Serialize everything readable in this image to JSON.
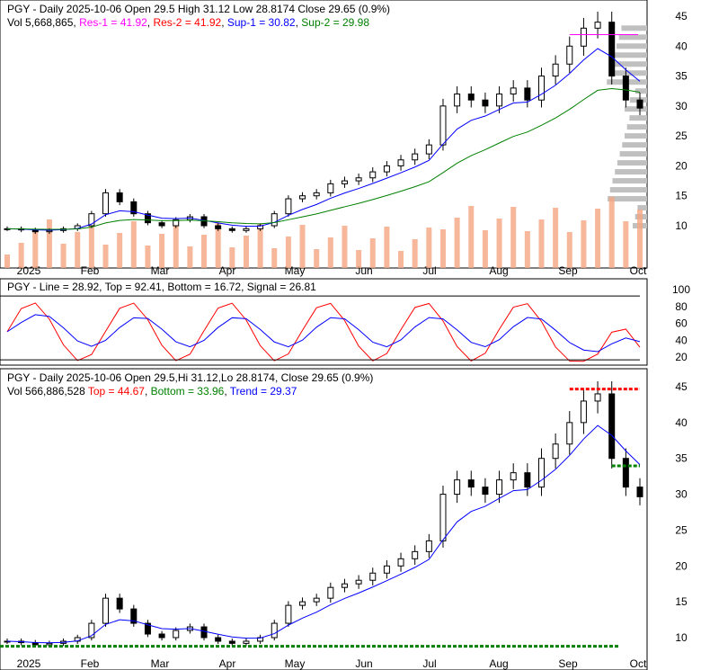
{
  "chart_data": [
    {
      "type": "candlestick",
      "title": "PGY - Daily 2025-10-06 Open 29.5  High 31.12  Low 28.8174  Close 29.65 (0.9%)",
      "legend": {
        "vol": "Vol 5,668,865",
        "res1": "Res-1 = 41.92",
        "res2": "Res-2 = 41.92",
        "sup1": "Sup-1 = 30.82",
        "sup2": "Sup-2 = 29.98"
      },
      "ylim": [
        8,
        46
      ],
      "yticks": [
        10,
        15,
        20,
        25,
        30,
        35,
        40,
        45
      ],
      "xticks": [
        "2025",
        "Feb",
        "Mar",
        "Apr",
        "May",
        "Jun",
        "Jul",
        "Aug",
        "Sep",
        "Oct"
      ],
      "weekly_close": [
        9.5,
        9.3,
        9.0,
        9.2,
        9.5,
        10,
        12,
        15.5,
        14,
        12,
        10.5,
        10,
        11,
        11.5,
        10,
        9.5,
        9.2,
        9.5,
        10,
        12,
        14.5,
        15,
        15.5,
        17,
        17.5,
        18,
        19,
        20,
        21,
        22,
        23.5,
        30,
        32,
        31,
        30,
        32,
        33,
        31,
        35,
        37,
        40,
        43,
        44,
        35,
        31,
        29.65
      ],
      "colors": {
        "res1": "#ff00ff",
        "res2": "#ff0000",
        "sup1": "#0000ff",
        "sup2": "#008000",
        "volume": "#f4a582"
      }
    },
    {
      "type": "line",
      "title": "PGY - Line = 28.92, Top = 92.41, Bottom = 16.72, Signal = 26.81",
      "ylim": [
        10,
        105
      ],
      "yticks": [
        20,
        40,
        60,
        80,
        100
      ]
    },
    {
      "type": "candlestick",
      "title": "PGY - Daily 2025-10-06 Open 29.5,Hi 31.12,Lo 28.8174, Close 29.65 (0.9%)",
      "legend": {
        "vol": "Vol 566,886,528",
        "top": "Top = 44.67",
        "bottom": "Bottom = 33.96",
        "trend": "Trend = 29.37"
      },
      "ylim": [
        8,
        47
      ],
      "yticks": [
        10,
        15,
        20,
        25,
        30,
        35,
        40,
        45
      ],
      "xticks": [
        "2025",
        "Feb",
        "Mar",
        "Apr",
        "May",
        "Jun",
        "Jul",
        "Aug",
        "Sep",
        "Oct"
      ]
    }
  ]
}
